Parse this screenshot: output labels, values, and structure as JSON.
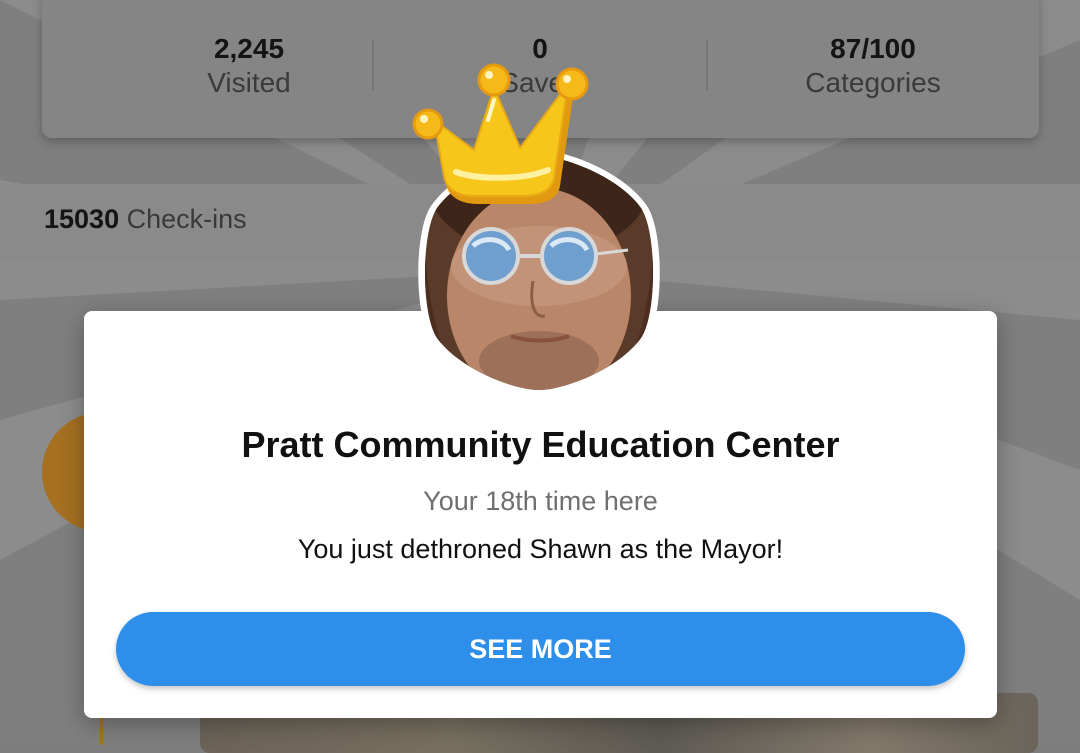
{
  "stats": [
    {
      "value": "2,245",
      "label": "Visited"
    },
    {
      "value": "0",
      "label": "Saved"
    },
    {
      "value": "87/100",
      "label": "Categories"
    }
  ],
  "checkins": {
    "count": "15030",
    "label": "Check-ins"
  },
  "modal": {
    "venue_name": "Pratt Community Education Center",
    "visit_count_text": "Your 18th time here",
    "mayor_message": "You just dethroned Shawn as the Mayor!",
    "button_label": "SEE MORE"
  },
  "colors": {
    "overlay_gray": "#7f7f7f",
    "button_blue": "#2d8fea",
    "crown_yellow": "#f6c61b",
    "orange_accent": "#a57022"
  },
  "icons": {
    "crown": "crown-icon",
    "avatar": "user-avatar"
  }
}
